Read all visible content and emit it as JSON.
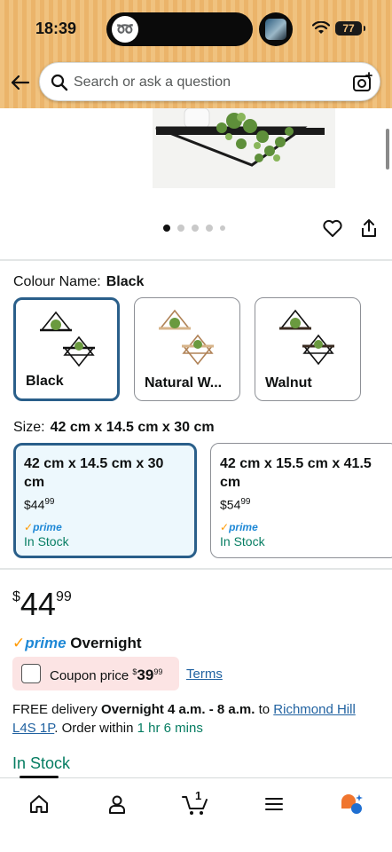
{
  "status_bar": {
    "time": "18:39",
    "battery_level": "77"
  },
  "header": {
    "search": {
      "placeholder": "Search or ask a question"
    }
  },
  "gallery": {
    "dots": 5,
    "active_dot": 0
  },
  "colour": {
    "label": "Colour Name:",
    "selected": "Black",
    "options": [
      {
        "label": "Black",
        "selected": true
      },
      {
        "label": "Natural W...",
        "selected": false
      },
      {
        "label": "Walnut",
        "selected": false
      }
    ]
  },
  "size": {
    "label": "Size:",
    "selected": "42 cm x 14.5 cm x 30 cm",
    "options": [
      {
        "title": "42 cm x 14.5 cm x 30 cm",
        "currency": "$",
        "price_whole": "44",
        "price_fraction": "99",
        "prime": "prime",
        "stock": "In Stock",
        "selected": true
      },
      {
        "title": "42 cm x 15.5 cm x 41.5 cm",
        "currency": "$",
        "price_whole": "54",
        "price_fraction": "99",
        "prime": "prime",
        "stock": "In Stock",
        "selected": false
      }
    ]
  },
  "price": {
    "currency": "$",
    "whole": "44",
    "fraction": "99"
  },
  "prime_delivery": {
    "prime": "prime",
    "label": "Overnight"
  },
  "coupon": {
    "text": "Coupon price",
    "currency": "$",
    "whole": "39",
    "fraction": "99",
    "terms": "Terms"
  },
  "delivery": {
    "prefix": "FREE delivery",
    "window": "Overnight 4 a.m. - 8 a.m.",
    "to": "to",
    "location": "Richmond Hill L4S 1P",
    "order_within_prefix": ". Order within",
    "countdown": "1 hr 6 mins"
  },
  "availability": "In Stock",
  "bottom_nav": {
    "cart_count": "1",
    "items": [
      "home-icon",
      "account-icon",
      "cart-icon",
      "menu-icon",
      "rufus-icon"
    ]
  },
  "colors": {
    "selected_border": "#2a5f8a",
    "prime_blue": "#1e88d6",
    "stock_green": "#067d62",
    "link_blue": "#2162a1",
    "coupon_bg": "#fce4e4",
    "header_orange": "#f0c27f"
  }
}
